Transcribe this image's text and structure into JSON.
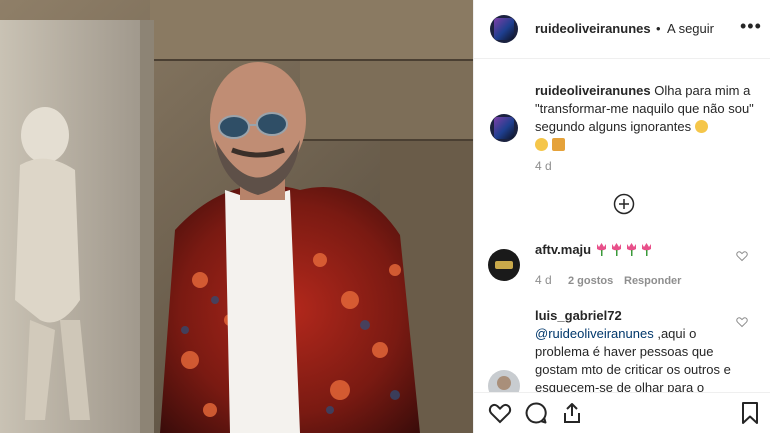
{
  "post": {
    "username": "ruideoliveiranunes",
    "separator": "•",
    "follow_label": "A seguir",
    "more_label": "•••",
    "caption_username": "ruideoliveiranunes",
    "caption_text": "Olha para mim a \"transformar-me naquilo que não sou\" segundo alguns ignorantes",
    "caption_time": "4 d"
  },
  "comments": [
    {
      "username": "aftv.maju",
      "text": "",
      "time": "4 d",
      "likes": "2 gostos",
      "reply": "Responder"
    },
    {
      "username": "luis_gabriel72",
      "mention": "@ruideoliveiranunes",
      "text": ",aqui o problema é haver pessoas que gostam mto de criticar os outros e esquecem-se de olhar para o"
    }
  ],
  "icons": {
    "like": "heart-icon",
    "comment": "comment-icon",
    "share": "share-icon",
    "save": "bookmark-icon",
    "load_more": "plus-circle-icon",
    "comment_like": "heart-outline-icon"
  },
  "colors": {
    "text": "#262626",
    "muted": "#8e8e8e",
    "mention": "#00376b",
    "border": "#efefef"
  }
}
